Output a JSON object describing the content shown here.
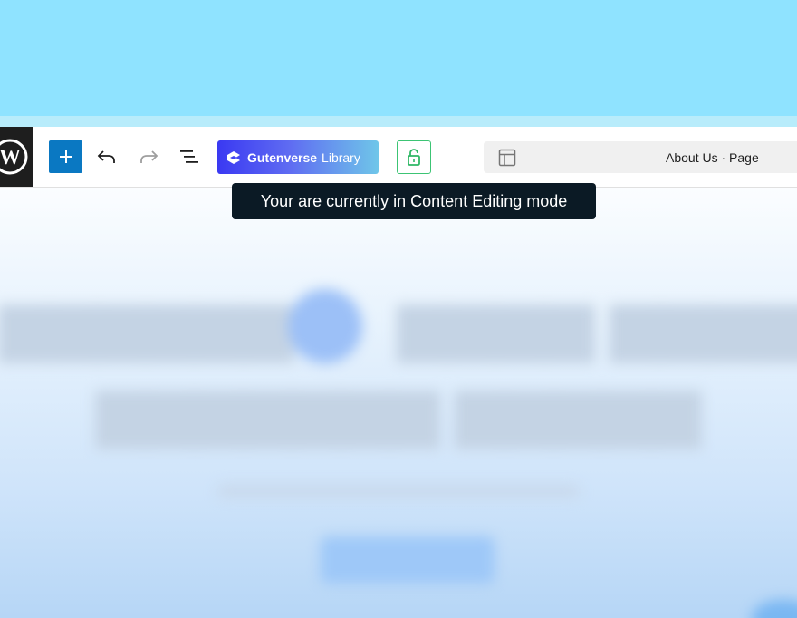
{
  "toolbar": {
    "add_icon": "plus-icon",
    "undo_icon": "undo-icon",
    "redo_icon": "redo-icon",
    "list_view_icon": "list-view-icon",
    "gutenverse_library": {
      "name": "Gutenverse",
      "label": "Library",
      "icon": "gutenverse-logo-icon"
    },
    "lock_icon": "unlock-icon",
    "document": {
      "icon": "layout-icon",
      "title": "About Us · Page"
    }
  },
  "tooltip": {
    "text": "Your are currently in Content Editing mode"
  },
  "colors": {
    "top_band": "#8fe3ff",
    "add_button": "#0a78c2",
    "lock_border": "#3cc474",
    "tooltip_bg": "#0b1a25",
    "wp_logo_bg": "#1e1e1e"
  }
}
